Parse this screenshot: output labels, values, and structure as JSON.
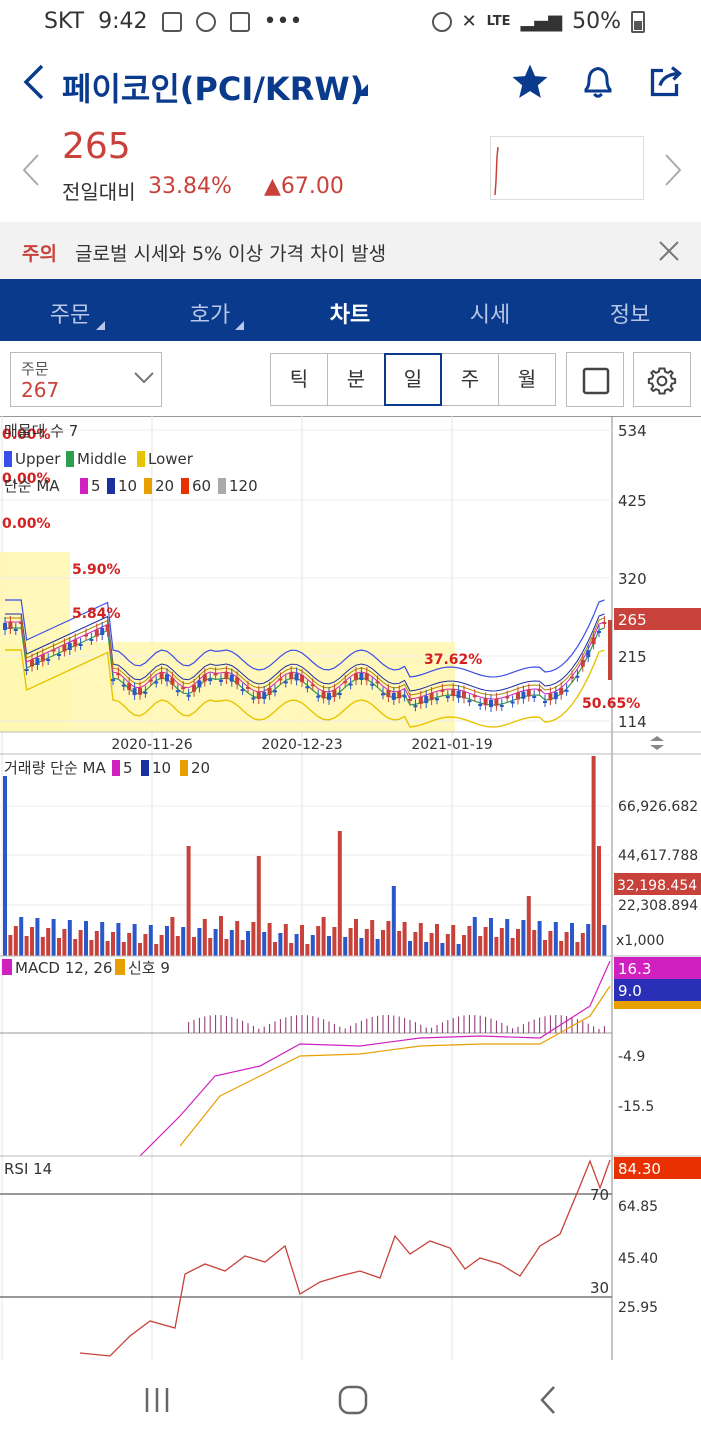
{
  "status_bar": {
    "carrier": "SKT",
    "time": "9:42",
    "network": "LTE",
    "battery": "50%"
  },
  "header": {
    "title": "페이코인(PCI/KRW)",
    "back_icon": "chevron-left-icon",
    "favorite_icon": "star-icon",
    "alarm_icon": "bell-icon",
    "share_icon": "share-icon",
    "accent": "#0a3a8c",
    "up_color": "#c8423b"
  },
  "quote": {
    "price": "265",
    "change_label": "전일대비",
    "change_pct": "33.84%",
    "change_abs": "▲67.00"
  },
  "notice": {
    "tag": "주의",
    "text": "글로벌 시세와 5% 이상 가격 차이 발생"
  },
  "tabs": [
    {
      "label": "주문",
      "active": false,
      "has_menu": true
    },
    {
      "label": "호가",
      "active": false,
      "has_menu": true
    },
    {
      "label": "차트",
      "active": true,
      "has_menu": false
    },
    {
      "label": "시세",
      "active": false,
      "has_menu": false
    },
    {
      "label": "정보",
      "active": false,
      "has_menu": false
    }
  ],
  "controls": {
    "order_label": "주문",
    "order_value": "267",
    "periods": [
      "틱",
      "분",
      "일",
      "주",
      "월"
    ],
    "active_period": "일"
  },
  "price_panel": {
    "legend_line1": "매물대 수 7",
    "bands": [
      "Upper",
      "Middle",
      "Lower"
    ],
    "band_colors": [
      "#3a4ee8",
      "#2e9e4f",
      "#e8c400"
    ],
    "ma_label": "단순 MA",
    "ma_periods": [
      "5",
      "10",
      "20",
      "60",
      "120"
    ],
    "ma_colors": [
      "#d020c0",
      "#1a2fa0",
      "#e8a000",
      "#e83000",
      "#aaaaaa"
    ],
    "y_ticks": [
      "534",
      "425",
      "320",
      "215",
      "114"
    ],
    "current_price_label": "265",
    "x_labels": [
      "2020-11-26",
      "2020-12-23",
      "2021-01-19"
    ],
    "volume_profile_labels": [
      "0.00%",
      "0.00%",
      "0.00%",
      "5.90%",
      "5.84%",
      "37.62%",
      "50.65%"
    ]
  },
  "volume_panel": {
    "label": "거래량 단순 MA",
    "ma_periods": [
      "5",
      "10",
      "20"
    ],
    "y_ticks": [
      "66,926.682",
      "44,617.788",
      "22,308.894"
    ],
    "current_label": "32,198.454",
    "unit": "x1,000"
  },
  "macd_panel": {
    "label": "MACD 12, 26",
    "signal_label": "신호 9",
    "macd_value": "16.3",
    "signal_value": "9.0",
    "y_ticks": [
      "-4.9",
      "-15.5"
    ]
  },
  "rsi_panel": {
    "label": "RSI 14",
    "current": "84.30",
    "level_high": "70",
    "level_low": "30",
    "y_ticks": [
      "64.85",
      "45.40",
      "25.95"
    ]
  }
}
